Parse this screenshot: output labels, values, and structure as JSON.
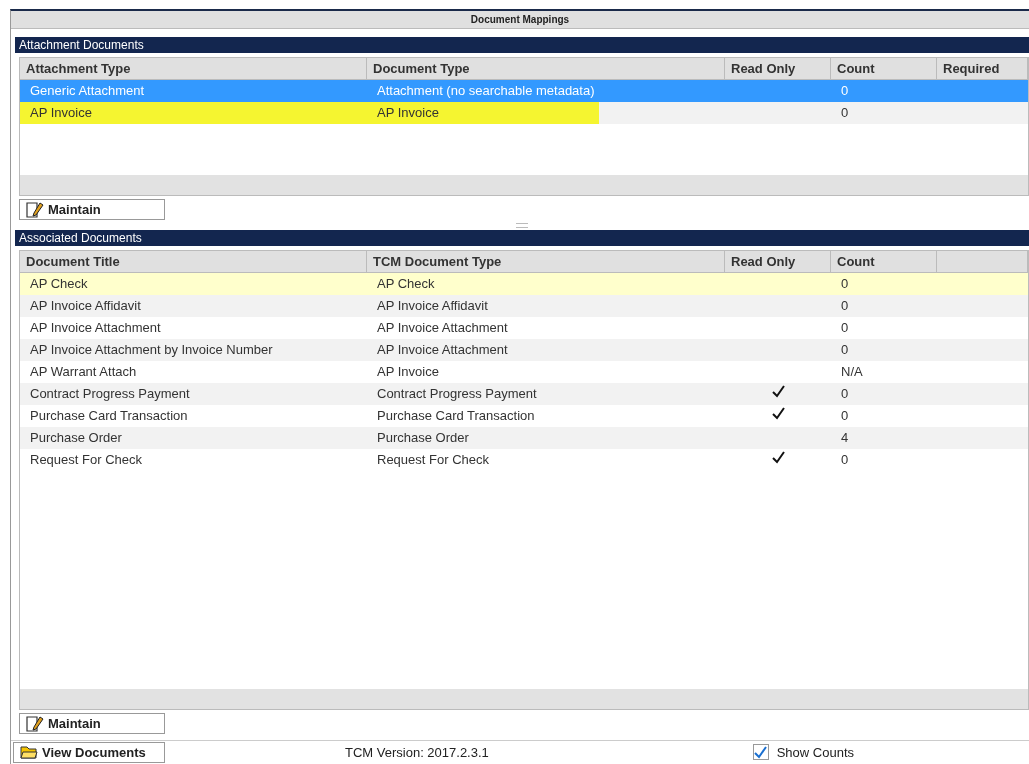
{
  "window": {
    "title": "Document Mappings"
  },
  "attachment_documents": {
    "title": "Attachment Documents",
    "columns": [
      "Attachment Type",
      "Document Type",
      "Read Only",
      "Count",
      "Required"
    ],
    "rows": [
      {
        "attachment_type": "Generic Attachment",
        "document_type": "Attachment (no searchable metadata)",
        "read_only": false,
        "count": "0",
        "selected": true,
        "highlighted": false
      },
      {
        "attachment_type": "AP Invoice",
        "document_type": "AP Invoice",
        "read_only": false,
        "count": "0",
        "selected": false,
        "highlighted": true
      }
    ],
    "button": "Maintain"
  },
  "associated_documents": {
    "title": "Associated Documents",
    "columns": [
      "Document Title",
      "TCM Document Type",
      "Read Only",
      "Count"
    ],
    "rows": [
      {
        "document_title": "AP Check",
        "tcm_document_type": "AP Check",
        "read_only": false,
        "count": "0",
        "selected": true
      },
      {
        "document_title": "AP Invoice Affidavit",
        "tcm_document_type": "AP Invoice Affidavit",
        "read_only": false,
        "count": "0",
        "selected": false
      },
      {
        "document_title": "AP Invoice Attachment",
        "tcm_document_type": "AP Invoice Attachment",
        "read_only": false,
        "count": "0",
        "selected": false
      },
      {
        "document_title": "AP Invoice Attachment by Invoice Number",
        "tcm_document_type": "AP Invoice Attachment",
        "read_only": false,
        "count": "0",
        "selected": false
      },
      {
        "document_title": "AP Warrant Attach",
        "tcm_document_type": "AP Invoice",
        "read_only": false,
        "count": "N/A",
        "selected": false
      },
      {
        "document_title": "Contract Progress Payment",
        "tcm_document_type": "Contract Progress Payment",
        "read_only": true,
        "count": "0",
        "selected": false
      },
      {
        "document_title": "Purchase Card Transaction",
        "tcm_document_type": "Purchase Card Transaction",
        "read_only": true,
        "count": "0",
        "selected": false
      },
      {
        "document_title": "Purchase Order",
        "tcm_document_type": "Purchase Order",
        "read_only": false,
        "count": "4",
        "selected": false
      },
      {
        "document_title": "Request For Check",
        "tcm_document_type": "Request For Check",
        "read_only": true,
        "count": "0",
        "selected": false
      }
    ],
    "button": "Maintain"
  },
  "footer": {
    "view_documents": "View Documents",
    "version": "TCM Version: 2017.2.3.1",
    "show_counts": {
      "label": "Show Counts",
      "checked": true
    }
  }
}
